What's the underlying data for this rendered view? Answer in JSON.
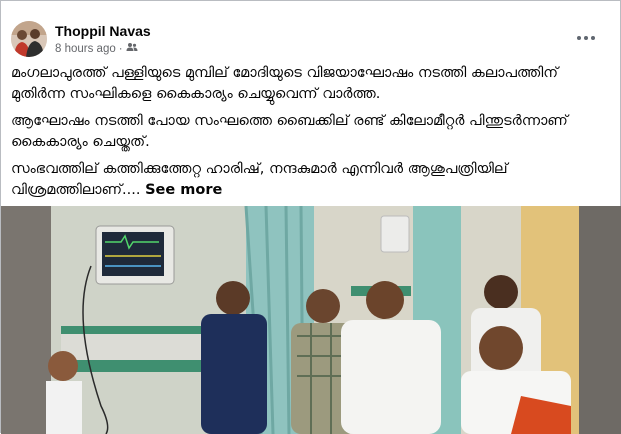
{
  "post": {
    "author": "Thoppil Navas",
    "time": "8 hours ago",
    "separator": "·",
    "audience_icon": "friends-icon",
    "more_icon": "more-horizontal-icon",
    "text": {
      "p1": "മംഗലാപുരത്ത് പള്ളിയുടെ മുമ്പില് മോദിയുടെ വിജയാഘോഷം നടത്തി കലാപത്തിന് മുതിർന്ന സംഘികളെ കൈകാര്യം ചെയ്യുവെന്ന് വാർത്ത.",
      "p2": "ആഘോഷം നടത്തി പോയ സംഘത്തെ ബൈക്കില് രണ്ട് കിലോമീറ്റർ പിന്തുടർന്നാണ് കൈകാര്യം ചെയ്തത്.",
      "p3": "സംഭവത്തില് കത്തിക്കുത്തേറ്റ ഹാരിഷ്, നന്ദകുമാർ എന്നിവർ ആശുപത്രിയില് വിശ്രമത്തിലാണ്....",
      "see_more": "See more"
    }
  },
  "colors": {
    "text": "#050505",
    "meta": "#65676b",
    "border": "#b9bcc1",
    "photo_frame": "#6f6a63"
  }
}
